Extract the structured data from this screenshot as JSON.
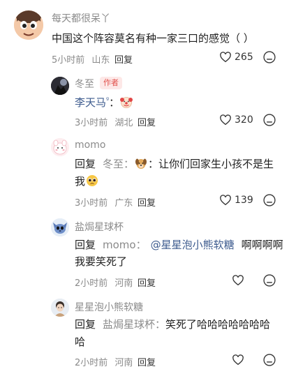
{
  "comments": [
    {
      "username": "每天都很呆丫",
      "text": "中国这个阵容莫名有种一家三口的感觉（ ）",
      "time": "5小时前",
      "location": "山东",
      "reply_label": "回复",
      "likes": "265"
    },
    {
      "username": "冬至",
      "badge": "作者",
      "text_prefix": "李天马",
      "text_superscript": "ᵍ",
      "text_colon": "：",
      "emoji": "clown-face",
      "time": "3小时前",
      "location": "湖北",
      "reply_label": "回复",
      "likes": "320"
    },
    {
      "username": "momo",
      "reply_word": "回复",
      "reply_to": "冬至：",
      "emoji1": "dog-face",
      "text_line1": "：让你们回家生小孩不是生",
      "text_line2": "我",
      "emoji2": "pleading-face",
      "time": "3小时前",
      "location": "广东",
      "reply_label": "回复",
      "likes": "139"
    },
    {
      "username": "盐焗星球杯",
      "reply_word": "回复",
      "reply_to": "momo：",
      "mention": "@星星泡小熊软糖",
      "text_line1": "啊啊啊啊",
      "text_line2": "我要笑死了",
      "time": "2小时前",
      "location": "河南",
      "reply_label": "回复",
      "likes": ""
    },
    {
      "username": "星星泡小熊软糖",
      "reply_word": "回复",
      "reply_to": "盐焗星球杯：",
      "text_line1": "笑死了哈哈哈哈哈哈哈",
      "text_line2": "哈",
      "time": "2小时前",
      "location": "河南",
      "reply_label": "回复",
      "likes": ""
    }
  ],
  "colors": {
    "username": "#8a8a8a",
    "text": "#1f1f1f",
    "mention": "#3d5b8e",
    "author_badge": "#e2534e"
  }
}
